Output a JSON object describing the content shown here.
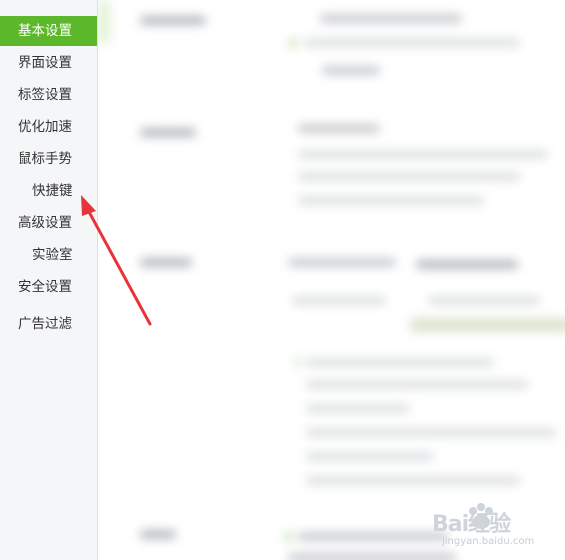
{
  "sidebar": {
    "items": [
      {
        "label": "基本设置"
      },
      {
        "label": "界面设置"
      },
      {
        "label": "标签设置"
      },
      {
        "label": "优化加速"
      },
      {
        "label": "鼠标手势"
      },
      {
        "label": "快捷键"
      },
      {
        "label": "高级设置"
      },
      {
        "label": "实验室"
      },
      {
        "label": "安全设置"
      },
      {
        "label": "广告过滤"
      }
    ],
    "active_index": 0
  },
  "watermark": {
    "logo": "Bai经验",
    "url": "jingyan.baidu.com"
  },
  "colors": {
    "active_bg": "#5cb82a",
    "arrow": "#e8333a",
    "sidebar_bg": "#f5f6f8"
  },
  "icons": [
    "red-arrow-annotation",
    "baidu-paw-icon"
  ]
}
